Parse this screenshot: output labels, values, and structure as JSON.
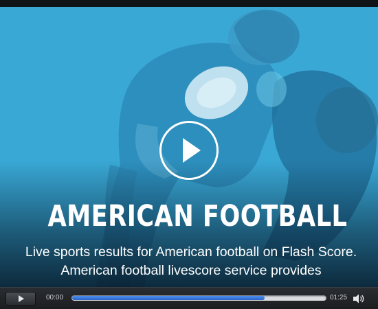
{
  "video": {
    "title": "AMERICAN FOOTBALL",
    "description": "Live sports results for American football on Flash Score. American football livescore service provides"
  },
  "controls": {
    "current_time": "00:00",
    "total_time": "01:25",
    "progress_fraction": 0.76
  },
  "icons": {
    "play_overlay": "play-icon",
    "play_button": "play-icon",
    "volume": "speaker-icon"
  },
  "colors": {
    "overlay_tint": "#3aa9d6",
    "progress_fill": "#3b7be0",
    "progress_track": "#d9dbde",
    "control_bar": "#222529"
  }
}
